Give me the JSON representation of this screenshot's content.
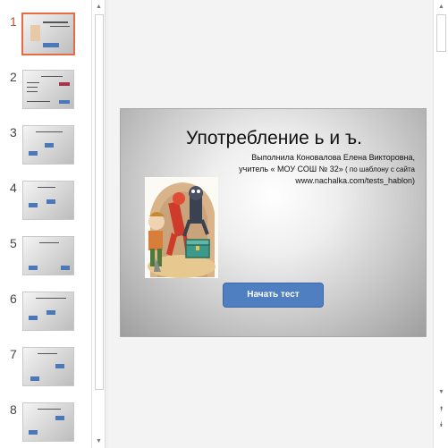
{
  "thumbnails": [
    {
      "number": "1",
      "active": true
    },
    {
      "number": "2",
      "active": false
    },
    {
      "number": "3",
      "active": false
    },
    {
      "number": "4",
      "active": false
    },
    {
      "number": "5",
      "active": false
    },
    {
      "number": "6",
      "active": false
    },
    {
      "number": "7",
      "active": false
    },
    {
      "number": "8",
      "active": false
    }
  ],
  "slide": {
    "title": "Употребление ь и ъ.",
    "author_line": "Выполнила Коновалова Елена Викторовна,",
    "school_line": "учитель « МОУ СОШ № 32»",
    "template_note": " ( по шаблону с сайта",
    "site_line": "www.nachalka.com/tests_hablon)",
    "start_button_label": "Начать тест",
    "picture_icon": "cartoon-illustration"
  },
  "scrollbars": {
    "up_glyph": "▲",
    "down_glyph": "▼",
    "prev_slide_glyph": "⯭",
    "next_slide_glyph": "⯯"
  },
  "colors": {
    "active_thumbnail_border": "#e66a43",
    "button_blue": "#4f7fc0"
  }
}
